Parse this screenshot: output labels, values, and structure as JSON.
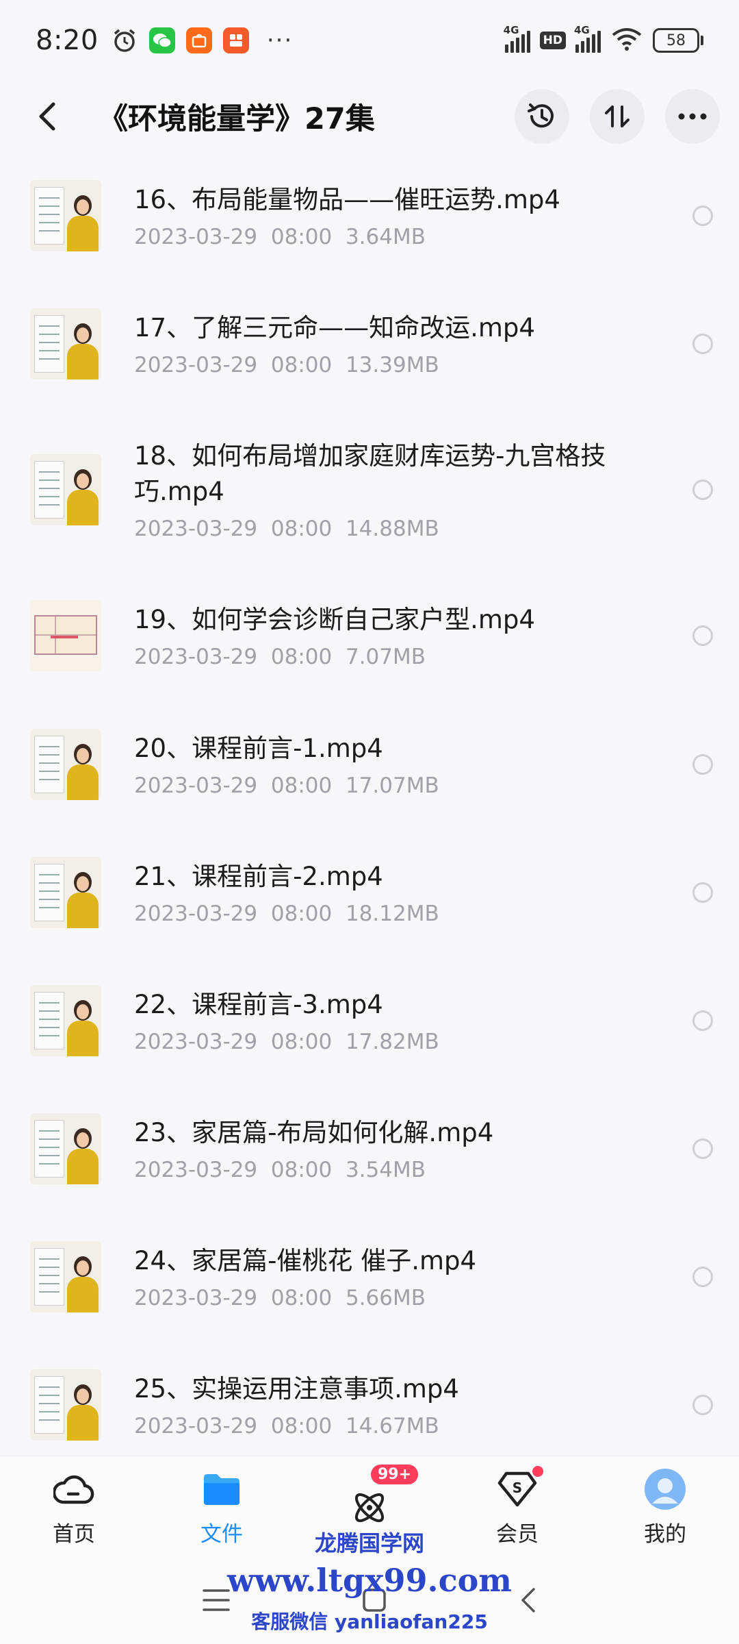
{
  "status_bar": {
    "time": "8:20",
    "net1": "4G",
    "hd": "HD",
    "net2": "4G",
    "battery": "58",
    "wechat_color": "#28c445",
    "taobao_color": "#ff6a1a",
    "app3_color": "#f25a2a"
  },
  "header": {
    "title": "《环境能量学》27集"
  },
  "files": [
    {
      "name": "16、布局能量物品——催旺运势.mp4",
      "date": "2023-03-29",
      "time": "08:00",
      "size": "3.64MB",
      "thumb": "teacher"
    },
    {
      "name": "17、了解三元命——知命改运.mp4",
      "date": "2023-03-29",
      "time": "08:00",
      "size": "13.39MB",
      "thumb": "teacher"
    },
    {
      "name": "18、如何布局增加家庭财库运势-九宫格技巧.mp4",
      "date": "2023-03-29",
      "time": "08:00",
      "size": "14.88MB",
      "thumb": "teacher"
    },
    {
      "name": "19、如何学会诊断自己家户型.mp4",
      "date": "2023-03-29",
      "time": "08:00",
      "size": "7.07MB",
      "thumb": "floorplan"
    },
    {
      "name": "20、课程前言-1.mp4",
      "date": "2023-03-29",
      "time": "08:00",
      "size": "17.07MB",
      "thumb": "teacher"
    },
    {
      "name": "21、课程前言-2.mp4",
      "date": "2023-03-29",
      "time": "08:00",
      "size": "18.12MB",
      "thumb": "teacher"
    },
    {
      "name": "22、课程前言-3.mp4",
      "date": "2023-03-29",
      "time": "08:00",
      "size": "17.82MB",
      "thumb": "teacher"
    },
    {
      "name": "23、家居篇-布局如何化解.mp4",
      "date": "2023-03-29",
      "time": "08:00",
      "size": "3.54MB",
      "thumb": "teacher"
    },
    {
      "name": "24、家居篇-催桃花 催子.mp4",
      "date": "2023-03-29",
      "time": "08:00",
      "size": "5.66MB",
      "thumb": "teacher"
    },
    {
      "name": "25、实操运用注意事项.mp4",
      "date": "2023-03-29",
      "time": "08:00",
      "size": "14.67MB",
      "thumb": "teacher"
    }
  ],
  "bottom_nav": {
    "home": "首页",
    "files": "文件",
    "explore_badge": "99+",
    "vip": "会员",
    "mine": "我的",
    "active_color": "#1a8cff"
  },
  "watermark": {
    "line1": "龙腾国学网",
    "line2": "www.ltgx99.com",
    "line3": "客服微信 yanliaofan225"
  }
}
